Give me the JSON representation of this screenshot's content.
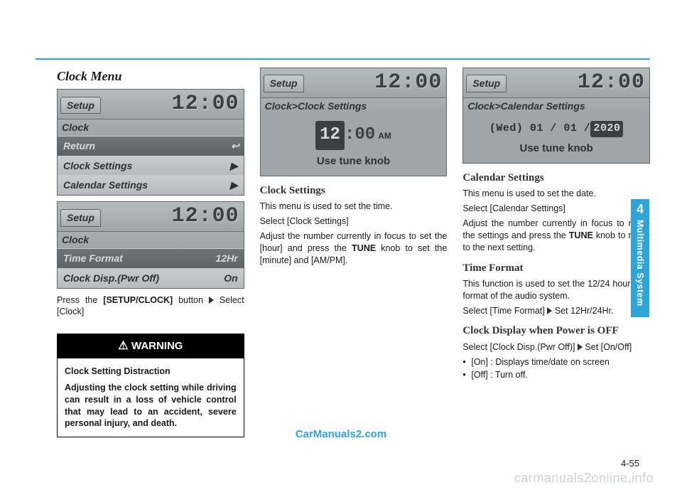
{
  "header": {
    "section_title": "Clock Menu"
  },
  "col1": {
    "screen1": {
      "tab": "Setup",
      "time": "12:00",
      "sub": "Clock",
      "rows": [
        {
          "label": "Return",
          "right": "↩",
          "sel": true
        },
        {
          "label": "Clock Settings",
          "right": "▶",
          "sel": false
        },
        {
          "label": "Calendar Settings",
          "right": "▶",
          "sel": false
        }
      ]
    },
    "screen2": {
      "tab": "Setup",
      "time": "12:00",
      "sub": "Clock",
      "rows": [
        {
          "label": "Time Format",
          "right": "12Hr",
          "sel": true
        },
        {
          "label": "Clock Disp.(Pwr Off)",
          "right": "On",
          "sel": false
        }
      ]
    },
    "instr_html": "Press the <b>[SETUP/CLOCK]</b> button <span class='tri'></span> Select [Clock]",
    "warning": {
      "title": "WARNING",
      "subtitle": "Clock Setting Distraction",
      "body": "Adjusting the clock setting while driving can result in a loss of vehicle control that may lead to an accident, severe personal injury, and death."
    }
  },
  "col2": {
    "screen": {
      "tab": "Setup",
      "time": "12:00",
      "crumb": "Clock>Clock Settings",
      "big_hour": "12",
      "colon": ":",
      "big_min": "00",
      "ampm": "AM",
      "usetune": "Use tune knob"
    },
    "h2": "Clock Settings",
    "p1": "This menu is used to set the time.",
    "p2": "Select [Clock Settings]",
    "p3_html": "Adjust the number currently in focus to set the [hour] and press the <b>TUNE</b> knob to set the [minute] and [AM/PM]."
  },
  "col3": {
    "screen": {
      "tab": "Setup",
      "time": "12:00",
      "crumb": "Clock>Calendar Settings",
      "date_pre": "(Wed) 01 / 01 /",
      "date_sel": "2020",
      "usetune": "Use tune knob"
    },
    "h2a": "Calendar Settings",
    "pa1": "This menu is used to set the date.",
    "pa2": "Select [Calendar Settings]",
    "pa3_html": "Adjust the number currently in focus to make the settings and press the <b>TUNE</b> knob to move to the next setting.",
    "h2b": "Time Format",
    "pb1": "This function is used to set the 12/24 hour time format of the audio system.",
    "pb2_html": "Select [Time Format] <span class='tri'></span> Set 12Hr/24Hr.",
    "h2c": "Clock Display when Power is OFF",
    "pc1_html": "Select [Clock Disp.(Pwr Off)] <span class='tri'></span> Set [On/Off]",
    "bullets": [
      "[On] : Displays time/date on screen",
      "[Off] : Turn off."
    ]
  },
  "side": {
    "num": "4",
    "label": "Multimedia System"
  },
  "footer": {
    "link": "CarManuals2.com",
    "pagenum": "4-55",
    "watermark": "carmanuals2online.info"
  }
}
